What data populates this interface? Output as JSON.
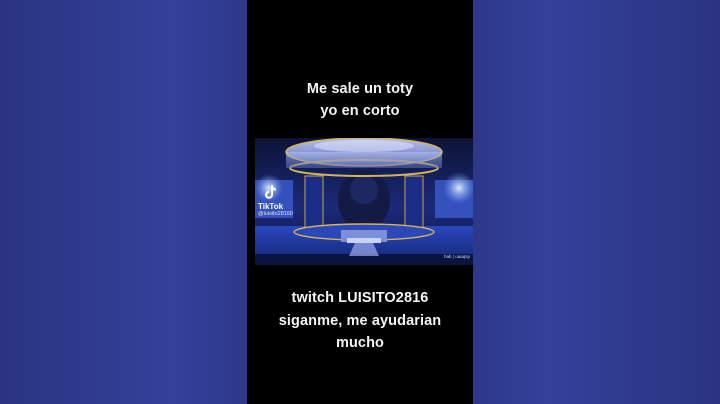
{
  "short": {
    "caption_top": [
      "Me sale un toty",
      "yo en corto"
    ],
    "caption_bottom": [
      "twitch LUISITO2816",
      "siganme, me ayudarian",
      "mucho"
    ]
  },
  "clip": {
    "tiktok_label": "TikTok",
    "tiktok_handle": "@luisito28160",
    "watermark": "hab | uaaqsp"
  },
  "colors": {
    "background": "#2e3a8c",
    "video_background": "#000000",
    "caption_text": "#f4f4f4"
  }
}
